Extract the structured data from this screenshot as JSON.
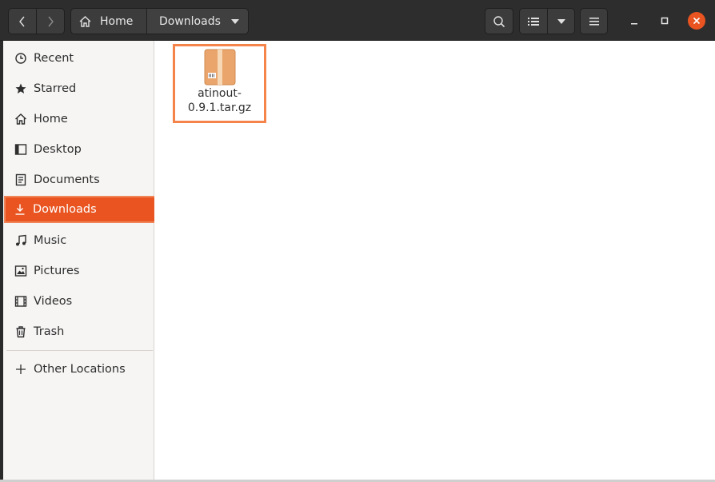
{
  "header": {
    "breadcrumb": {
      "home_label": "Home",
      "current_label": "Downloads"
    }
  },
  "sidebar": {
    "items": [
      {
        "label": "Recent",
        "icon": "clock-icon"
      },
      {
        "label": "Starred",
        "icon": "star-icon"
      },
      {
        "label": "Home",
        "icon": "home-icon"
      },
      {
        "label": "Desktop",
        "icon": "desktop-icon"
      },
      {
        "label": "Documents",
        "icon": "document-icon"
      },
      {
        "label": "Downloads",
        "icon": "download-icon",
        "active": true
      },
      {
        "label": "Music",
        "icon": "music-icon"
      },
      {
        "label": "Pictures",
        "icon": "pictures-icon"
      },
      {
        "label": "Videos",
        "icon": "video-icon"
      },
      {
        "label": "Trash",
        "icon": "trash-icon"
      }
    ],
    "other_locations": {
      "label": "Other Locations",
      "icon": "plus-icon"
    }
  },
  "content": {
    "files": [
      {
        "name_line1": "atinout-",
        "name_line2": "0.9.1.tar.gz",
        "icon": "archive-icon"
      }
    ]
  },
  "colors": {
    "accent": "#e95420",
    "highlight_border": "#f5844a",
    "headerbar": "#2d2d2d"
  }
}
